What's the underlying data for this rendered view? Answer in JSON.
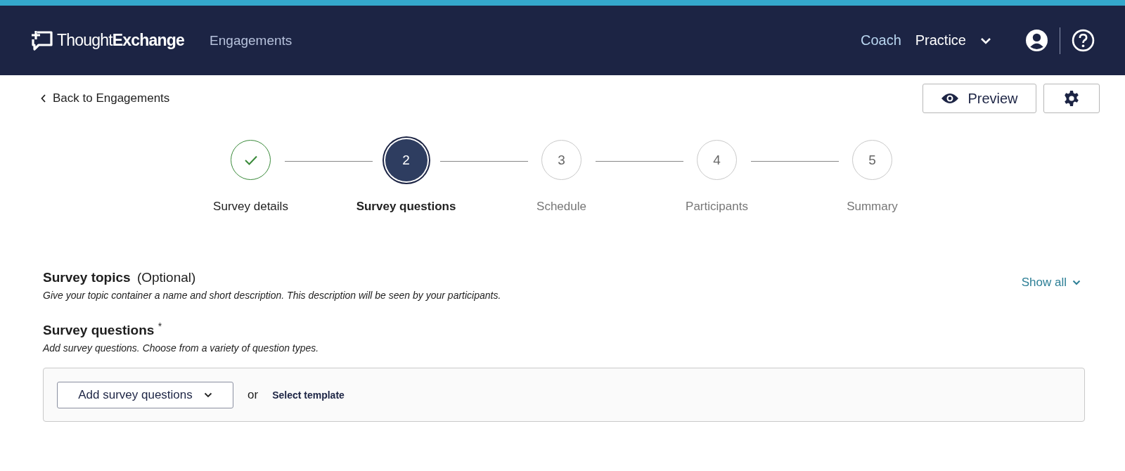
{
  "header": {
    "logo": "Thought**Exchange**",
    "nav": "Engagements",
    "coach": "Coach",
    "practice": "Practice"
  },
  "back_link": "Back to Engagements",
  "preview_button": "Preview",
  "steps": [
    {
      "label": "Survey details",
      "completed": true,
      "selected": false
    },
    {
      "number": "2",
      "label": "Survey questions",
      "completed": false,
      "selected": true
    },
    {
      "number": "3",
      "label": "Schedule",
      "completed": false,
      "selected": false
    },
    {
      "number": "4",
      "label": "Participants",
      "completed": false,
      "selected": false
    },
    {
      "number": "5",
      "label": "Summary",
      "completed": false,
      "selected": false
    }
  ],
  "topics": {
    "title": "Survey topics",
    "optional": "(Optional)",
    "description": "Give your topic container a name and short description. This description will be seen by your participants.",
    "show_all": "Show all"
  },
  "questions": {
    "title": "Survey questions",
    "required_mark": "*",
    "description": "Add survey questions. Choose from a variety of question types.",
    "add_button": "Add survey questions",
    "or": "or",
    "template_link": "Select template"
  }
}
